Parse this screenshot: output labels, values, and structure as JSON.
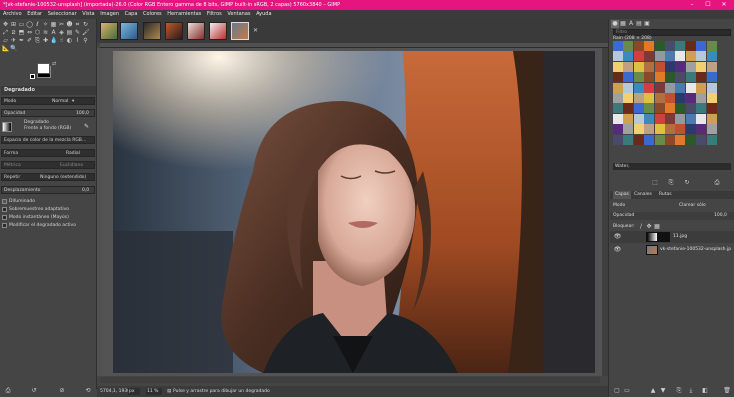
{
  "window": {
    "title": "*[vk-stefanie-100532-unsplash] (importada)-26.0 (Color RGB Entero gamma de 8 bits, GIMP built-in sRGB, 2 capas) 5760x3840 – GIMP",
    "minimize": "–",
    "maximize": "☐",
    "close": "✕"
  },
  "menu": [
    "Archivo",
    "Editar",
    "Seleccionar",
    "Vista",
    "Imagen",
    "Capa",
    "Colores",
    "Herramientas",
    "Filtros",
    "Ventanas",
    "Ayuda"
  ],
  "tool_options": {
    "tab_title": "Degradado",
    "mode_label": "Modo",
    "mode_value": "Normal",
    "opacity_label": "Opacidad",
    "opacity_value": "100,0",
    "gradient_label": "Degradado",
    "gradient_name": "Frente a fondo (RGB)",
    "blend_space": "Espacio de color de la mezcla RGB...",
    "shape_label": "Forma",
    "shape_value": "Radial",
    "metric_label": "Métrica",
    "metric_value": "Euclidiano",
    "repeat_label": "Repetir",
    "repeat_value": "Ninguno (extendido)",
    "offset_label": "Desplazamiento",
    "offset_value": "0,0",
    "dithering": "Difuminado",
    "adaptive": "Sobremuestreo adaptativo",
    "instant": "Modo instantáneo (Mayús)",
    "modify_active": "Modificar el degradado activo"
  },
  "status": {
    "coords": "5704,1, 1930,1",
    "unit": "px",
    "zoom": "11 %",
    "message": "Pulse y arrastre para dibujar un degradado"
  },
  "patterns": {
    "filter_placeholder": "Filtro",
    "pattern_name": "Rain (208 × 208)",
    "tag_value": "Water,"
  },
  "layers": {
    "tabs": [
      "Capas",
      "Canales",
      "Rutas"
    ],
    "mode_label": "Modo",
    "mode_value": "Clarear sólo",
    "opacity_label": "Opacidad",
    "opacity_value": "100,0",
    "lock_label": "Bloquear:",
    "items": [
      {
        "name": "11.jpg"
      },
      {
        "name": "vk-stefanie-100532-unsplash.jp"
      }
    ]
  },
  "colors": {
    "accent": "#e5147f",
    "bg": "#454545"
  }
}
